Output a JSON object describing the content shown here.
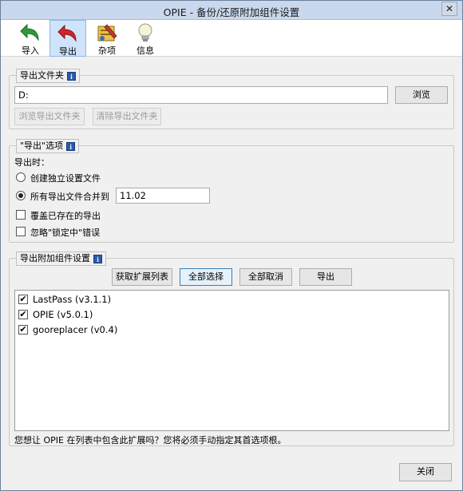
{
  "window": {
    "title": "OPIE - 备份/还原附加组件设置",
    "close_glyph": "✕"
  },
  "toolbar": {
    "items": [
      {
        "label": "导入",
        "icon": "import-arrow-icon",
        "active": false
      },
      {
        "label": "导出",
        "icon": "export-arrow-icon",
        "active": true
      },
      {
        "label": "杂项",
        "icon": "misc-tools-icon",
        "active": false
      },
      {
        "label": "信息",
        "icon": "info-bulb-icon",
        "active": false
      }
    ]
  },
  "export_folder": {
    "title": "导出文件夹",
    "path_value": "D:",
    "browse_label": "浏览",
    "browse_folder_label": "浏览导出文件夹",
    "clear_folder_label": "清除导出文件夹"
  },
  "export_options": {
    "title": "\"导出\"选项",
    "when_label": "导出时：",
    "radio_separate": "创建独立设置文件",
    "radio_merge": "所有导出文件合并到",
    "merge_filename": "11.02",
    "overwrite_label": "覆盖已存在的导出",
    "ignore_locked_label": "忽略\"锁定中\"错误"
  },
  "addon_settings": {
    "title": "导出附加组件设置",
    "get_list_label": "获取扩展列表",
    "select_all_label": "全部选择",
    "deselect_all_label": "全部取消",
    "export_label": "导出",
    "addons": [
      {
        "name": "LastPass (v3.1.1)",
        "checked": true
      },
      {
        "name": "OPIE (v5.0.1)",
        "checked": true
      },
      {
        "name": "gooreplacer (v0.4)",
        "checked": true
      }
    ],
    "hint": "您想让 OPIE 在列表中包含此扩展吗？您将必须手动指定其首选项根。"
  },
  "footer": {
    "close_label": "关闭"
  },
  "check_glyph": "✔",
  "info_glyph": "i"
}
